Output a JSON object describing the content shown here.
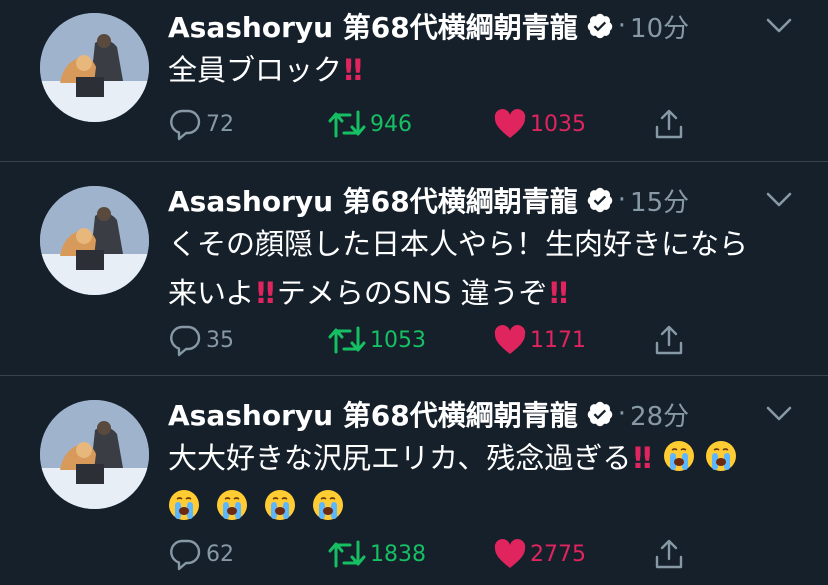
{
  "tweets": [
    {
      "name": "Asashoryu 第68代横綱朝青龍",
      "time": "10分",
      "line1": "全員ブロック",
      "line2": "",
      "reply_count": "72",
      "retweet_count": "946",
      "like_count": "1035"
    },
    {
      "name": "Asashoryu 第68代横綱朝青龍",
      "time": "15分",
      "line1": "くその顔隠した日本人やら！生肉好きになら",
      "line2_a": "来いよ",
      "line2_b": "テメらのSNS 違うぞ",
      "reply_count": "35",
      "retweet_count": "1053",
      "like_count": "1171"
    },
    {
      "name": "Asashoryu 第68代横綱朝青龍",
      "time": "28分",
      "line1": "大大好きな沢尻エリカ、残念過ぎる",
      "reply_count": "62",
      "retweet_count": "1838",
      "like_count": "2775"
    }
  ],
  "separator": "·",
  "exclamation": "!!",
  "icons": [
    "verified-icon",
    "chevron-down-icon",
    "reply-icon",
    "retweet-icon",
    "like-icon",
    "share-icon",
    "crying-face-emoji"
  ],
  "colors": {
    "background": "#15202b",
    "muted": "#8899a6",
    "retweet": "#17bf63",
    "like": "#e0245e",
    "divider": "#38444d"
  }
}
